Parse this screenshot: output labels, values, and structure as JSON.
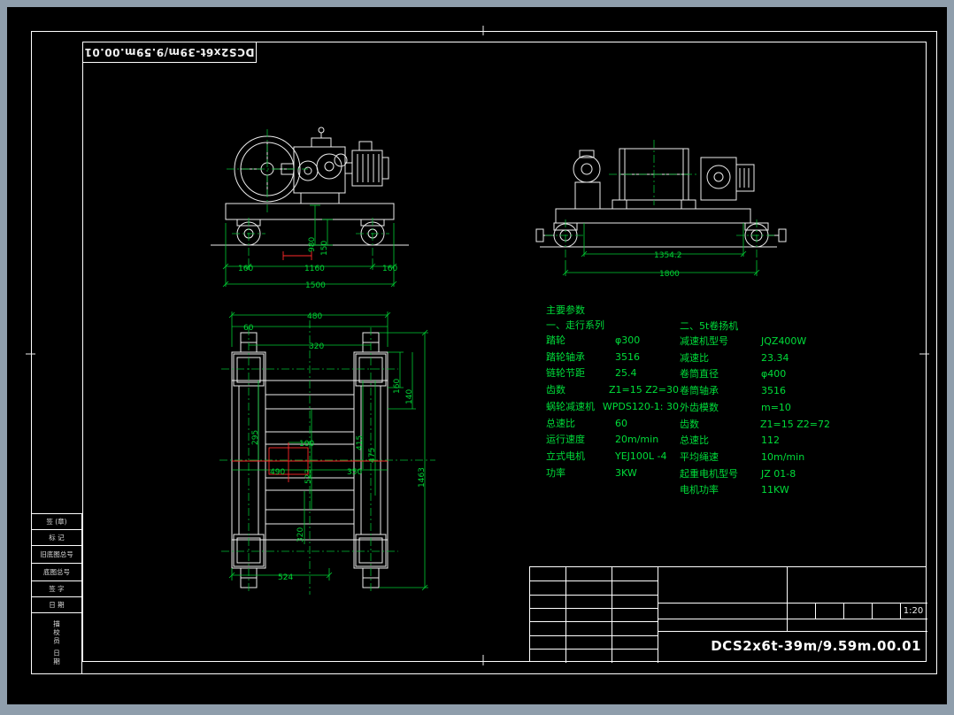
{
  "sheet": {
    "flipped_title": "DCS2x6t-39m/9.59m.00.01"
  },
  "title_block": {
    "drawing_number": "DCS2x6t-39m/9.59m.00.01",
    "scale": "1:20"
  },
  "left_strip": {
    "rows": [
      "签 (章)",
      "标  记",
      "旧底图总号",
      "底图总号",
      "签  字",
      "日  期",
      "描校员 日期"
    ]
  },
  "params": {
    "header": "主要参数",
    "s1": {
      "title": "一、走行系列",
      "rows": [
        [
          "踏轮",
          "φ300"
        ],
        [
          "踏轮轴承",
          "3516"
        ],
        [
          "链轮节距",
          "25.4"
        ],
        [
          "齿数",
          "Z1=15  Z2=30"
        ],
        [
          "蜗轮减速机",
          "WPDS120-1: 30"
        ],
        [
          "总速比",
          "60"
        ],
        [
          "运行速度",
          "20m/min"
        ],
        [
          "立式电机",
          "YEJ100L -4"
        ],
        [
          "功率",
          "3KW"
        ]
      ]
    },
    "s2": {
      "title": "二、5t卷扬机",
      "rows": [
        [
          "减速机型号",
          "JQZ400W"
        ],
        [
          "减速比",
          "23.34"
        ],
        [
          "卷筒直径",
          "φ400"
        ],
        [
          "卷筒轴承",
          "3516"
        ],
        [
          "外齿模数",
          "m=10"
        ],
        [
          "齿数",
          "Z1=15  Z2=72"
        ],
        [
          "总速比",
          "112"
        ],
        [
          "平均绳速",
          "10m/min"
        ],
        [
          "起重电机型号",
          "JZ 01-8"
        ],
        [
          "电机功率",
          "11KW"
        ]
      ]
    }
  },
  "dims": {
    "front": [
      "160",
      "1160",
      "160",
      "1500",
      "980",
      "150"
    ],
    "side": [
      "1354.2",
      "1800"
    ],
    "plan": [
      "480",
      "60",
      "320",
      "160",
      "140",
      "295",
      "415",
      "475",
      "1463",
      "523",
      "100",
      "490",
      "350",
      "320",
      "524"
    ]
  },
  "colors": {
    "linework": "#ededed",
    "centerline": "#00bb33",
    "dimension": "#00cc33",
    "highlight": "#ff2a2a"
  }
}
